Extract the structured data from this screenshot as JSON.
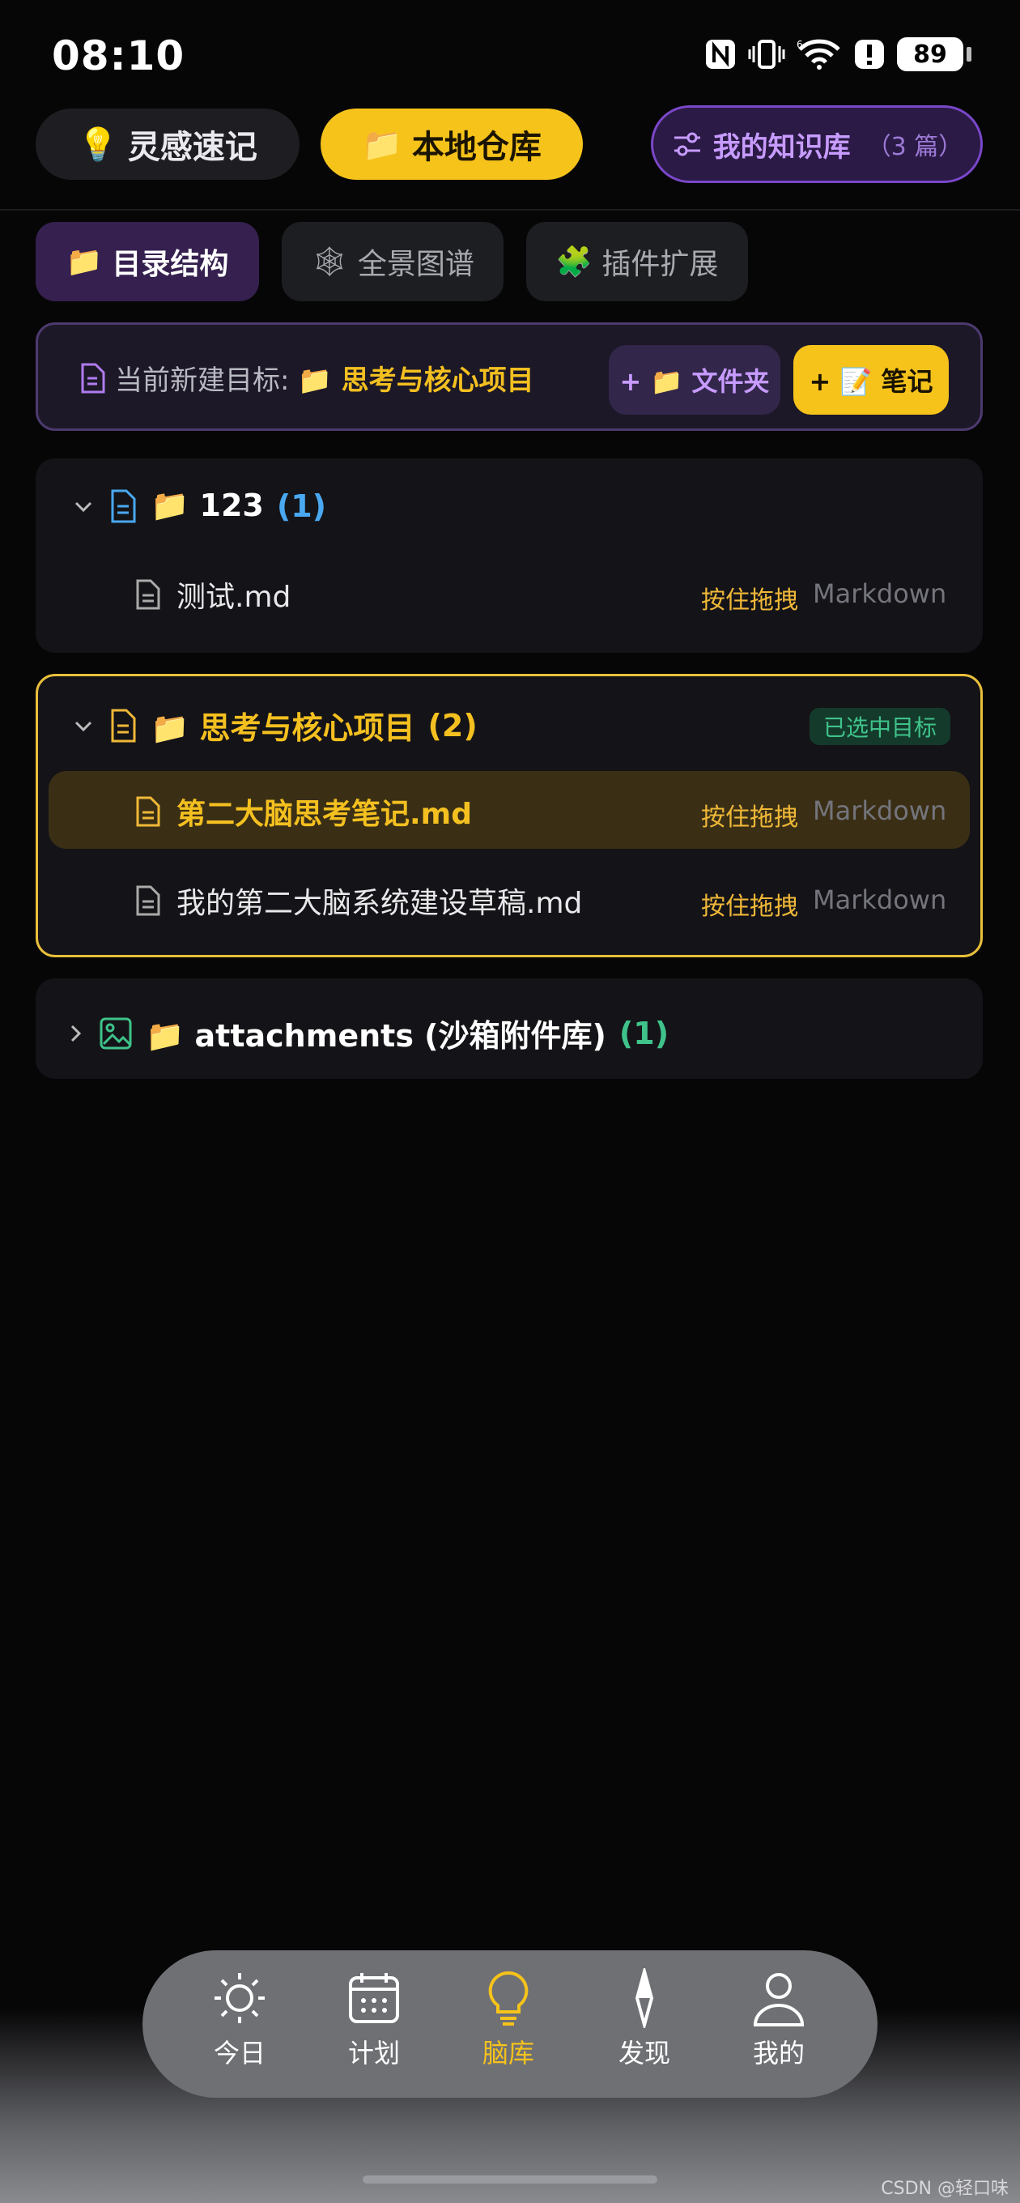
{
  "status_bar": {
    "time": "08:10",
    "battery": "89"
  },
  "top_tabs": {
    "idea": {
      "emoji": "💡",
      "label": "灵感速记"
    },
    "local": {
      "emoji": "📁",
      "label": "本地仓库"
    },
    "kb": {
      "label": "我的知识库",
      "count": "（3 篇）"
    }
  },
  "sub_tabs": [
    {
      "emoji": "📁",
      "label": "目录结构"
    },
    {
      "emoji": "🕸",
      "label": "全景图谱"
    },
    {
      "emoji": "🧩",
      "label": "插件扩展"
    }
  ],
  "target": {
    "prefix": "当前新建目标:",
    "name": "📁 思考与核心项目",
    "add_folder": "+ 📁 文件夹",
    "add_note": "+ 📝 笔记"
  },
  "folders": [
    {
      "name": "📁 123",
      "count": "(1)",
      "files": [
        {
          "name": "测试.md",
          "drag": "按住拖拽",
          "type": "Markdown"
        }
      ]
    },
    {
      "name": "📁 思考与核心项目",
      "count": "(2)",
      "badge": "已选中目标",
      "files": [
        {
          "name": "第二大脑思考笔记.md",
          "drag": "按住拖拽",
          "type": "Markdown"
        },
        {
          "name": "我的第二大脑系统建设草稿.md",
          "drag": "按住拖拽",
          "type": "Markdown"
        }
      ]
    },
    {
      "name": "📁 attachments (沙箱附件库)",
      "count": "(1)"
    }
  ],
  "bottom_nav": [
    {
      "icon": "sun-icon",
      "label": "今日"
    },
    {
      "icon": "calendar-icon",
      "label": "计划"
    },
    {
      "icon": "bulb-icon",
      "label": "脑库",
      "active": true
    },
    {
      "icon": "compass-icon",
      "label": "发现"
    },
    {
      "icon": "person-icon",
      "label": "我的"
    }
  ],
  "watermark": "CSDN @轻口味",
  "colors": {
    "accent_yellow": "#f6c31b",
    "accent_purple": "#c79bff",
    "accent_blue": "#4aa8f0",
    "accent_green": "#3fc38a"
  }
}
